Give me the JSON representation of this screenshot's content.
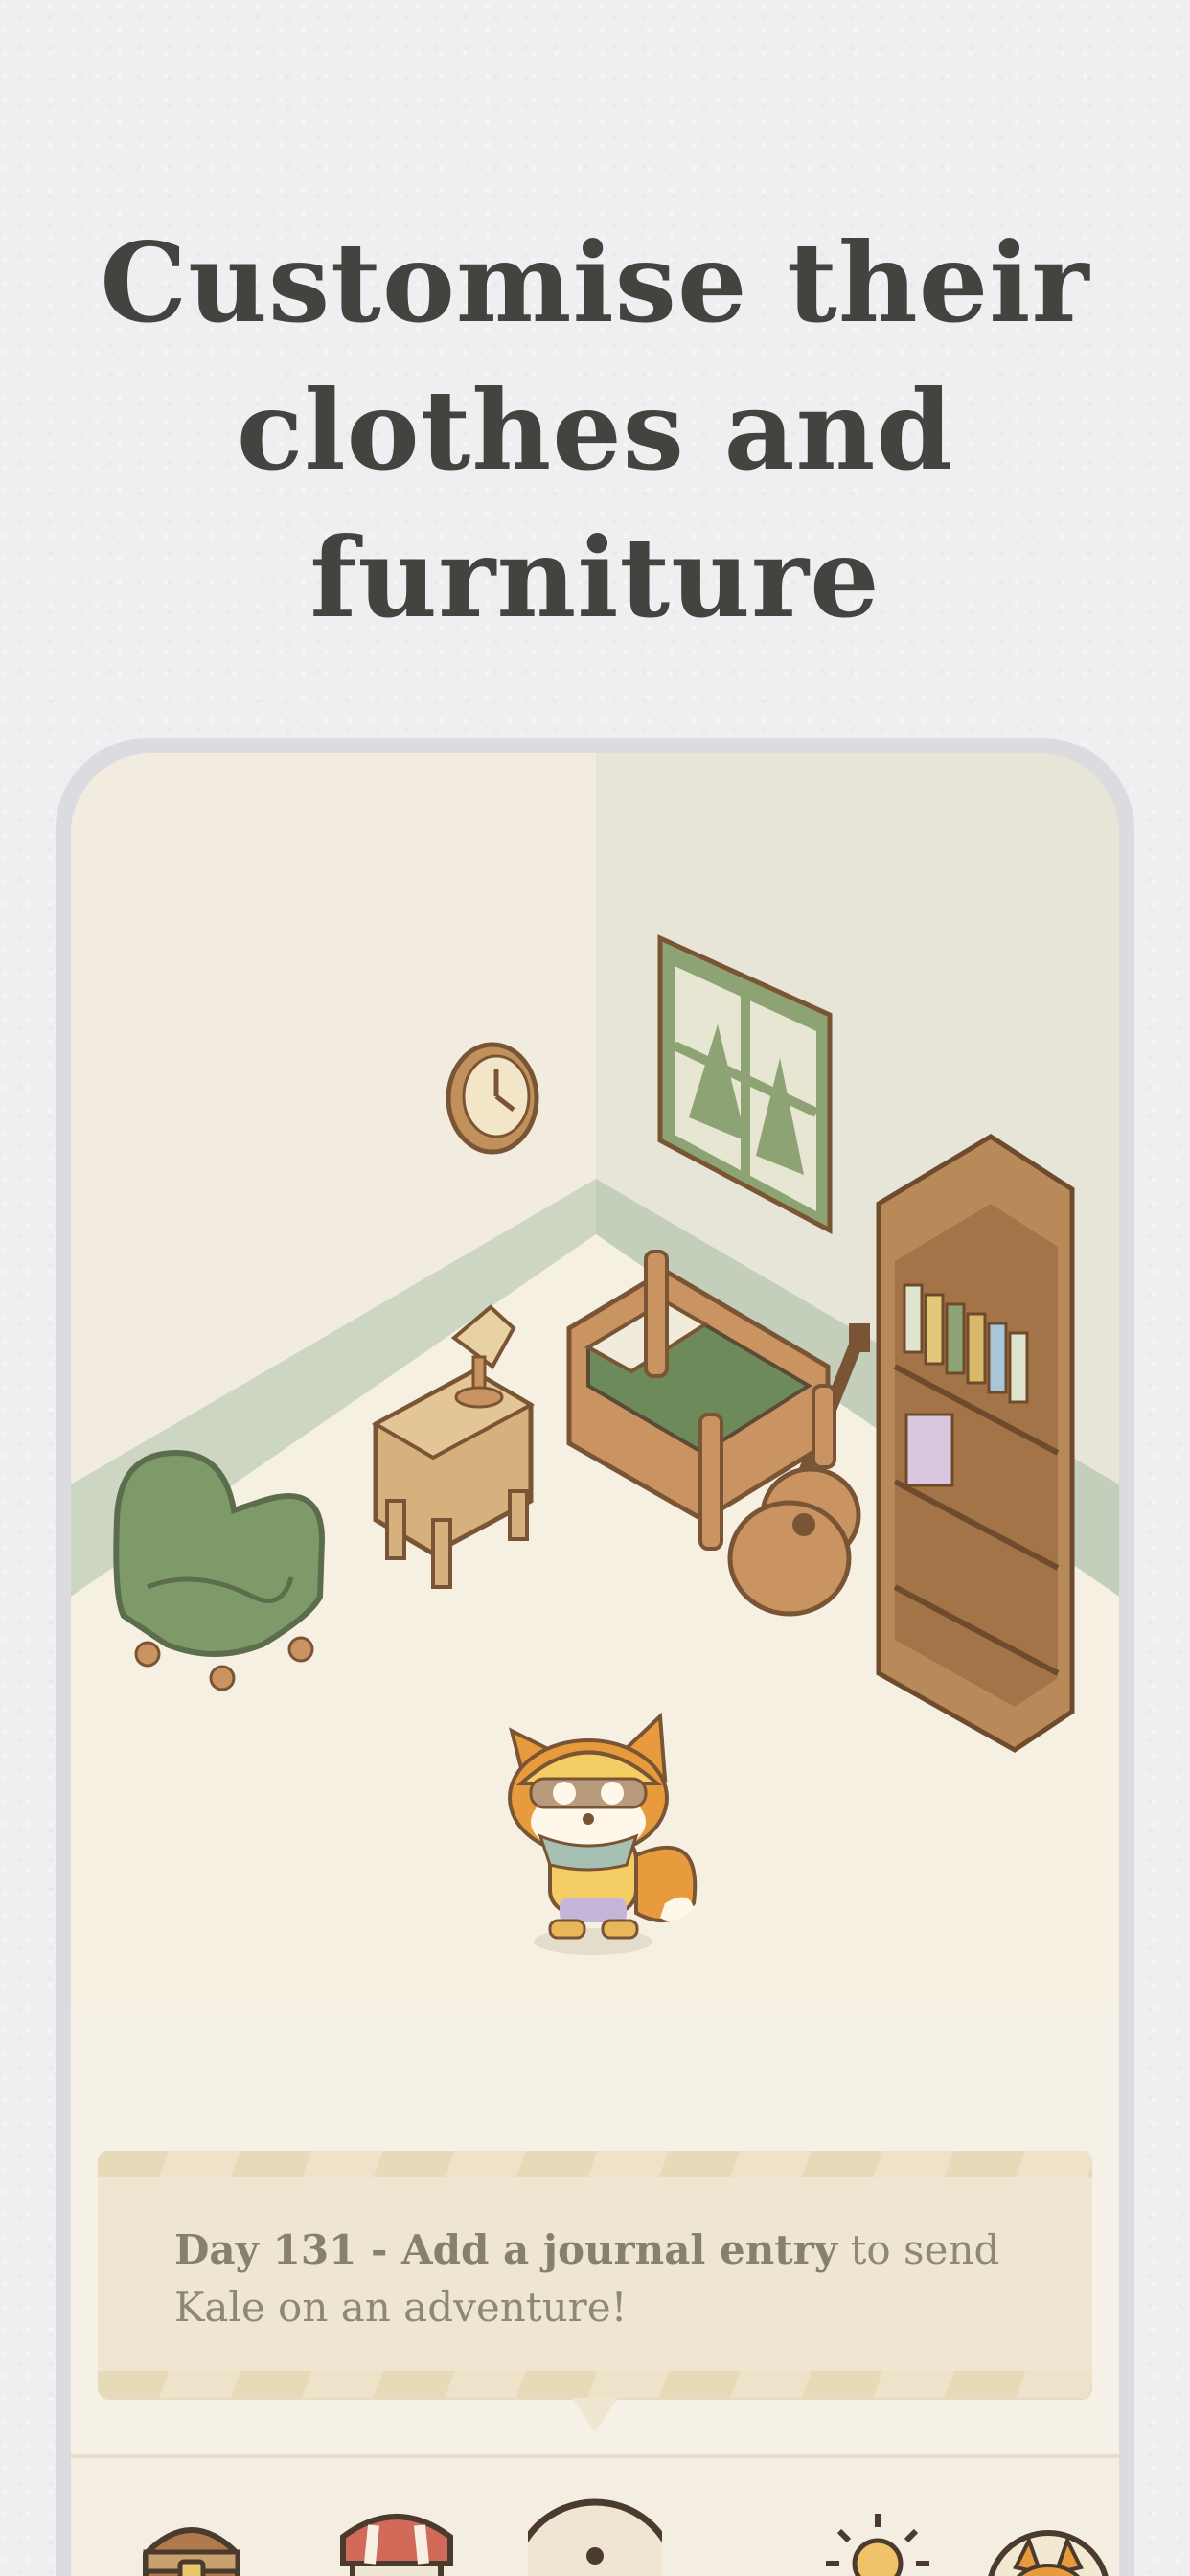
{
  "headline": {
    "line1": "Customise their",
    "line2": "clothes and",
    "line3": "furniture"
  },
  "journal": {
    "bold_text": "Day 131 - Add a journal entry",
    "rest_text": " to send Kale on an adventure!"
  },
  "tabs": [
    {
      "icon": "treasure-chest-icon"
    },
    {
      "icon": "shop-icon"
    },
    {
      "icon": "bubble-icon"
    },
    {
      "icon": "sun-icon"
    },
    {
      "icon": "fox-profile-icon"
    }
  ],
  "colors": {
    "background": "#efeff1",
    "headline": "#45433f",
    "screen": "#f5f1e6",
    "wall_left": "#f1ecdf",
    "wall_right": "#e6e4d6",
    "wall_trim": "#c7d1bd",
    "floor": "#f5efe2",
    "green": "#6d8a5a",
    "wood": "#c0915b"
  }
}
